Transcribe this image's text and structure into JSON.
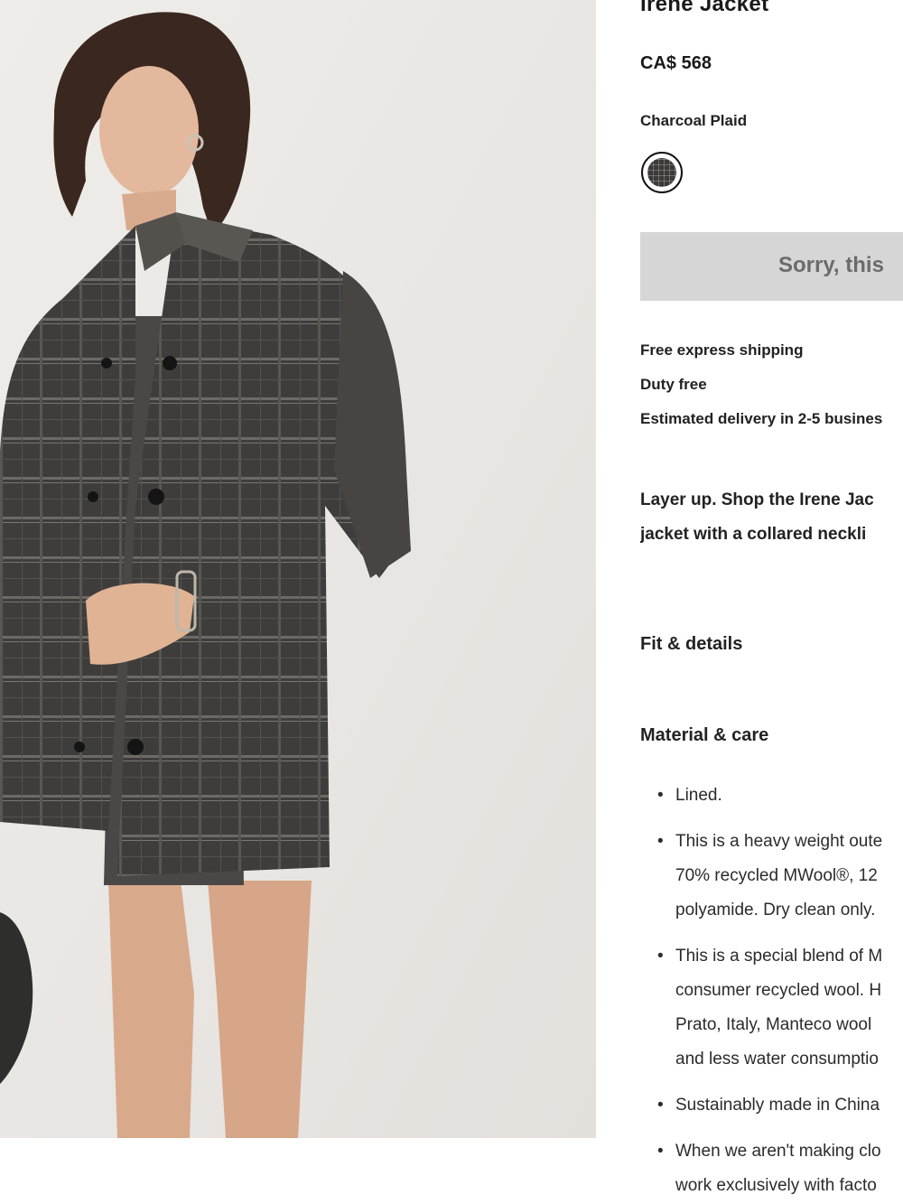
{
  "product": {
    "title": "Irene Jacket",
    "price": "CA$ 568",
    "color_name": "Charcoal Plaid",
    "image_alt": "Model wearing the Irene Jacket in Charcoal Plaid"
  },
  "swatch_icon": "charcoal-plaid-swatch",
  "cta": {
    "label": "Sorry, this"
  },
  "shipping": {
    "line1": "Free express shipping",
    "line2": "Duty free",
    "line3": "Estimated delivery in 2-5 busines"
  },
  "description": {
    "line1": "Layer up. Shop the Irene Jac",
    "line2": "jacket with a collared neckli"
  },
  "sections": {
    "fit": "Fit & details",
    "material": "Material & care"
  },
  "care_items": [
    {
      "lines": [
        "Lined."
      ]
    },
    {
      "lines": [
        "This is a heavy weight oute",
        "70% recycled MWool®, 12",
        "polyamide. Dry clean only."
      ]
    },
    {
      "lines": [
        "This is a special blend of M",
        "consumer recycled wool. H",
        "Prato, Italy, Manteco wool",
        "and less water consumptio"
      ]
    },
    {
      "lines": [
        "Sustainably made in China"
      ]
    },
    {
      "lines": [
        "When we aren't making clo",
        "work exclusively with facto"
      ]
    }
  ]
}
